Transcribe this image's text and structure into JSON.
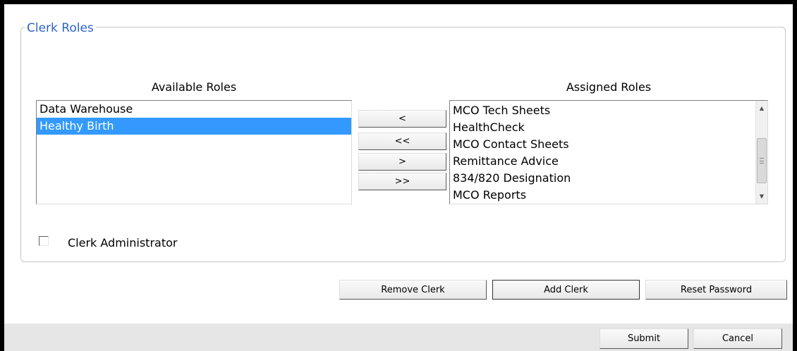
{
  "fieldset": {
    "legend": "Clerk Roles"
  },
  "available_roles": {
    "label": "Available Roles",
    "items": [
      "Data Warehouse",
      "Healthy Birth"
    ],
    "selected": "Healthy Birth"
  },
  "assigned_roles": {
    "label": "Assigned Roles",
    "items": [
      "MCO Tech Sheets",
      "HealthCheck",
      "MCO Contact Sheets",
      "Remittance Advice",
      "834/820 Designation",
      "MCO Reports"
    ]
  },
  "transfer_buttons": {
    "move_left": "<",
    "move_all_left": "<<",
    "move_right": ">",
    "move_all_right": ">>"
  },
  "clerk_admin": {
    "label": "Clerk Administrator",
    "checked": false
  },
  "actions": {
    "remove_clerk": "Remove Clerk",
    "add_clerk": "Add Clerk",
    "reset_password": "Reset Password"
  },
  "footer": {
    "submit": "Submit",
    "cancel": "Cancel"
  },
  "colors": {
    "accent": "#2f64c8",
    "selection": "#3399ff",
    "footer_bg": "#e6e6e6"
  }
}
